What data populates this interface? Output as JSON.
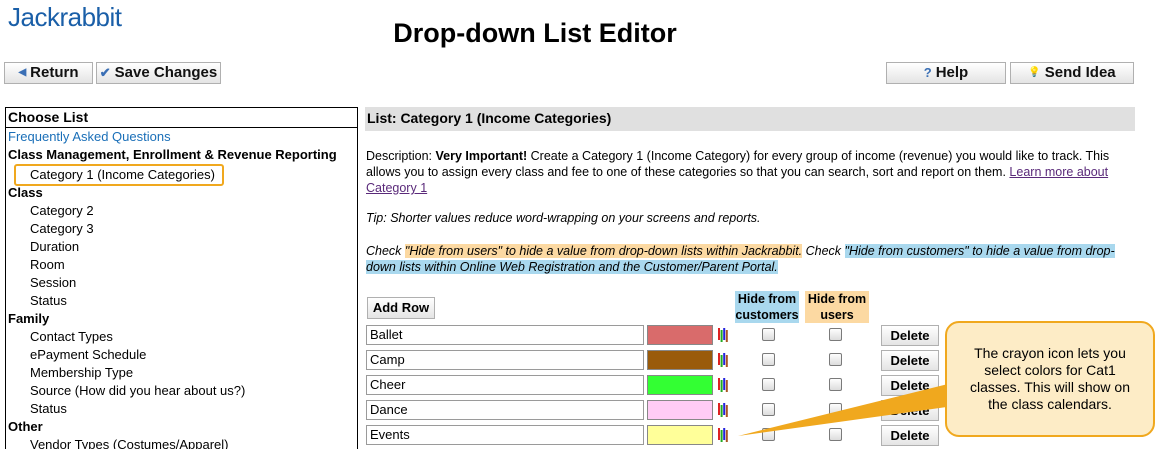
{
  "app": {
    "logo": "Jackrabbit",
    "title": "Drop-down List Editor"
  },
  "toolbar": {
    "return_label": "Return",
    "save_label": "Save Changes",
    "help_label": "Help",
    "idea_label": "Send Idea"
  },
  "left": {
    "header": "Choose List",
    "faq": "Frequently Asked Questions",
    "groups": [
      {
        "label": "Class Management, Enrollment & Revenue Reporting",
        "items": [
          "Category 1 (Income Categories)"
        ]
      },
      {
        "label": "Class",
        "items": [
          "Category 2",
          "Category 3",
          "Duration",
          "Room",
          "Session",
          "Status"
        ]
      },
      {
        "label": "Family",
        "items": [
          "Contact Types",
          "ePayment Schedule",
          "Membership Type",
          "Source (How did you hear about us?)",
          "Status"
        ]
      },
      {
        "label": "Other",
        "items": [
          "Vendor Types (Costumes/Apparel)"
        ]
      }
    ]
  },
  "main": {
    "header": "List: Category 1 (Income Categories)",
    "description_prefix": "Description: ",
    "description_bold": "Very Important!",
    "description_text": " Create a Category 1 (Income Category) for every group of income (revenue) you would like to track. This allows you to assign every class and fee to one of these categories so that you can search, sort and report on them. ",
    "learn_more": "Learn more about Category 1",
    "tip": "Tip: Shorter values reduce word-wrapping on your screens and reports.",
    "check_prefix": "Check ",
    "check_users": "\"Hide from users\" to hide a value from drop-down lists within Jackrabbit.",
    "check_mid": " Check ",
    "check_customers": "\"Hide from customers\" to hide a value from drop-down lists within Online Web Registration and the Customer/Parent Portal.",
    "add_row": "Add Row",
    "col_customers": "Hide from customers",
    "col_users": "Hide from users",
    "delete_label": "Delete",
    "rows": [
      {
        "value": "Ballet",
        "color": "#d96b6b"
      },
      {
        "value": "Camp",
        "color": "#9a5b0a"
      },
      {
        "value": "Cheer",
        "color": "#33ff33"
      },
      {
        "value": "Dance",
        "color": "#ffccf5"
      },
      {
        "value": "Events",
        "color": "#ffff99"
      }
    ]
  },
  "callout": {
    "text": "The crayon icon lets you select colors for Cat1 classes. This will show on the class calendars."
  },
  "icons": {
    "return": "left-triangle-icon",
    "save": "check-icon",
    "help": "question-icon",
    "idea": "lightbulb-icon",
    "crayon": "crayon-icon"
  }
}
